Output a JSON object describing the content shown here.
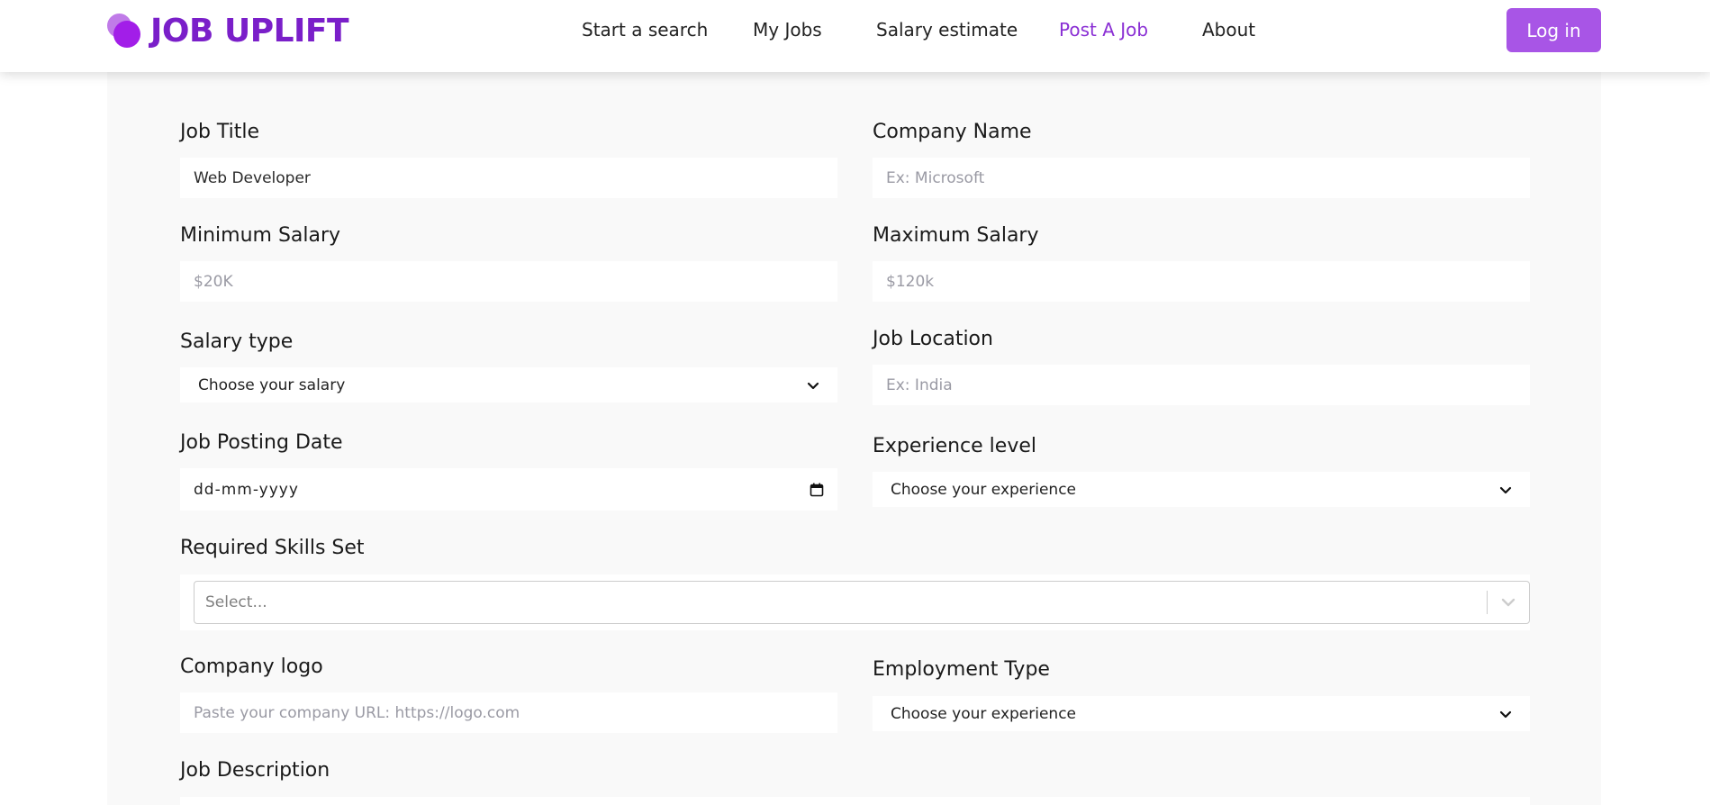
{
  "header": {
    "logo_text": "JOB UPLIFT",
    "nav": [
      {
        "label": "Start a search"
      },
      {
        "label": "My Jobs"
      },
      {
        "label": "Salary estimate"
      },
      {
        "label": "Post A Job",
        "active": true
      },
      {
        "label": "About"
      }
    ],
    "login_label": "Log in"
  },
  "colors": {
    "brand": "#7a1fc9",
    "accent": "#a855e6",
    "active_nav": "#8a2fd4",
    "panel_bg": "#f9f9f9"
  },
  "form": {
    "job_title": {
      "label": "Job Title",
      "value": "Web Developer"
    },
    "company_name": {
      "label": "Company Name",
      "placeholder": "Ex: Microsoft"
    },
    "min_salary": {
      "label": "Minimum Salary",
      "placeholder": "$20K"
    },
    "max_salary": {
      "label": "Maximum Salary",
      "placeholder": "$120k"
    },
    "salary_type": {
      "label": "Salary type",
      "selected": "Choose your salary"
    },
    "job_location": {
      "label": "Job Location",
      "placeholder": "Ex: India"
    },
    "posting_date": {
      "label": "Job Posting Date",
      "value": "dd-mm-yyyy"
    },
    "experience_level": {
      "label": "Experience level",
      "selected": "Choose your experience"
    },
    "skills": {
      "label": "Required Skills Set",
      "placeholder": "Select..."
    },
    "company_logo": {
      "label": "Company logo",
      "placeholder": "Paste your company URL: https://logo.com"
    },
    "employment_type": {
      "label": "Employment Type",
      "selected": "Choose your experience"
    },
    "job_description": {
      "label": "Job Description"
    }
  }
}
